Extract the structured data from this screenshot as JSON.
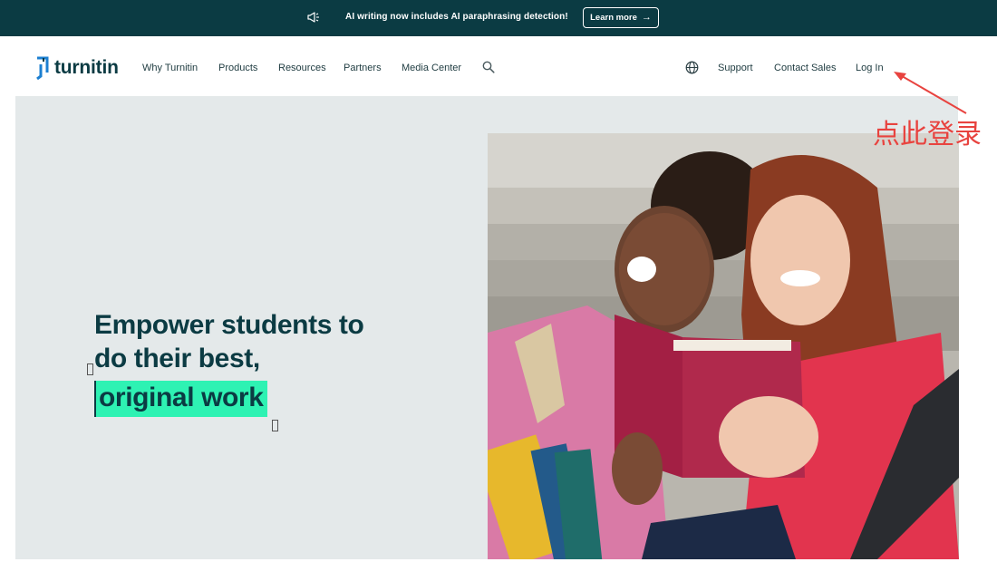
{
  "announcement": {
    "message": "AI writing now includes AI paraphrasing detection!",
    "cta_label": "Learn more",
    "icon": "megaphone-icon"
  },
  "brand": {
    "name": "turnitin",
    "logo_icon": "turnitin-logo-icon"
  },
  "nav": {
    "left_items": [
      "Why Turnitin",
      "Products",
      "Resources",
      "Partners",
      "Media Center"
    ],
    "search_icon": "search-icon",
    "globe_icon": "globe-icon",
    "right_items": [
      "Support",
      "Contact Sales",
      "Log In"
    ]
  },
  "hero": {
    "headline_line1": "Empower students to",
    "headline_line2": "do their best,",
    "headline_highlight": "original work",
    "image": "two-students-laughing-reading-book"
  },
  "annotation": {
    "text": "点此登录",
    "color": "#e8433f"
  },
  "colors": {
    "brand_dark": "#0b3b43",
    "highlight": "#2ef2b3",
    "hero_bg": "#e4e9ea"
  }
}
